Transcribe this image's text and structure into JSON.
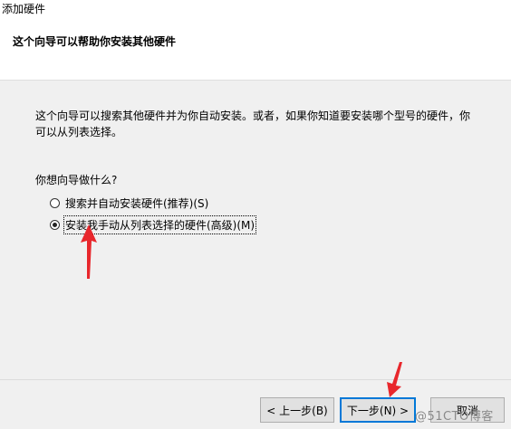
{
  "window": {
    "title": "添加硬件"
  },
  "header": {
    "heading": "这个向导可以帮助你安装其他硬件"
  },
  "content": {
    "intro_line1": "这个向导可以搜索其他硬件并为你自动安装。或者，如果你知道要安装哪个型号的硬件，你",
    "intro_line2": "可以从列表选择。",
    "question": "你想向导做什么?",
    "options": [
      {
        "label": "搜索并自动安装硬件(推荐)(S)",
        "checked": false
      },
      {
        "label": "安装我手动从列表选择的硬件(高级)(M)",
        "checked": true
      }
    ]
  },
  "buttons": {
    "back": "< 上一步(B)",
    "next": "下一步(N) >",
    "cancel": "取消"
  },
  "watermark": "@51CTO博客",
  "annotation_color": "#e8272c"
}
